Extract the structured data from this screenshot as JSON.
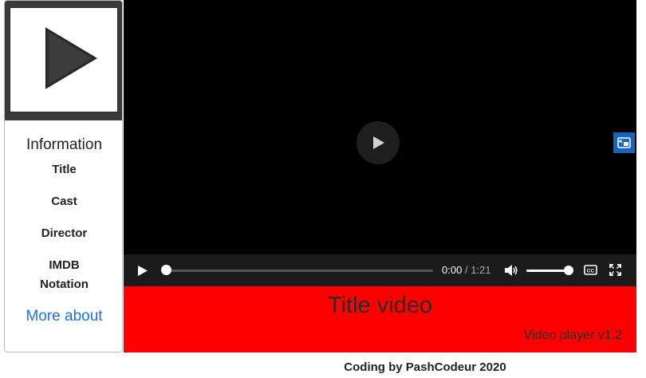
{
  "sidebar": {
    "thumbnail_icon": "play-triangle-icon",
    "info_heading": "Information",
    "items": [
      {
        "label": "Title"
      },
      {
        "label": "Cast"
      },
      {
        "label": "Director"
      },
      {
        "label": "IMDB\nNotation"
      }
    ],
    "more_link": "More about"
  },
  "player": {
    "current_time": "0:00",
    "separator": "/",
    "duration": "1:21",
    "progress_fraction": 0,
    "volume_fraction": 1.0,
    "icons": {
      "big_play": "play-icon",
      "pip": "picture-in-picture-icon",
      "play": "play-icon",
      "volume": "volume-icon",
      "captions": "captions-icon",
      "fullscreen": "fullscreen-icon"
    },
    "accent_color": "#1565c0"
  },
  "banner": {
    "title": "Title video",
    "version": "Video player v1.2",
    "background": "#ff0000"
  },
  "footer": {
    "text": "Coding by PashCodeur 2020"
  }
}
